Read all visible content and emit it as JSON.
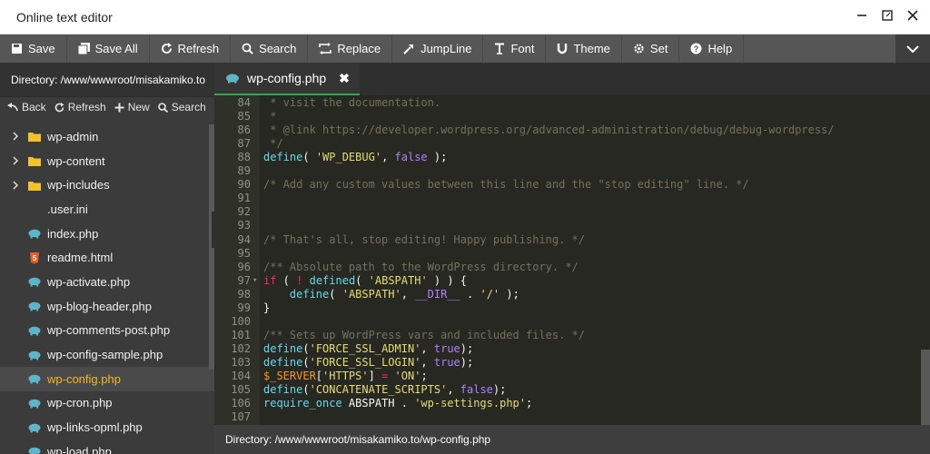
{
  "window": {
    "title": "Online text editor"
  },
  "toolbar": {
    "buttons": [
      {
        "label": "Save",
        "icon": "save-icon"
      },
      {
        "label": "Save All",
        "icon": "save-all-icon"
      },
      {
        "label": "Refresh",
        "icon": "refresh-icon"
      },
      {
        "label": "Search",
        "icon": "search-icon"
      },
      {
        "label": "Replace",
        "icon": "replace-icon"
      },
      {
        "label": "JumpLine",
        "icon": "jumpline-icon"
      },
      {
        "label": "Font",
        "icon": "font-icon"
      },
      {
        "label": "Theme",
        "icon": "theme-icon"
      },
      {
        "label": "Set",
        "icon": "gear-icon"
      },
      {
        "label": "Help",
        "icon": "help-icon"
      }
    ]
  },
  "sidebar": {
    "directory_label": "Directory: /www/wwwroot/misakamiko.to",
    "actions": [
      {
        "label": "Back",
        "icon": "back-icon"
      },
      {
        "label": "Refresh",
        "icon": "refresh-icon"
      },
      {
        "label": "New",
        "icon": "plus-icon"
      },
      {
        "label": "Search",
        "icon": "search-icon"
      }
    ],
    "files": [
      {
        "name": "wp-admin",
        "type": "folder"
      },
      {
        "name": "wp-content",
        "type": "folder"
      },
      {
        "name": "wp-includes",
        "type": "folder"
      },
      {
        "name": ".user.ini",
        "type": "file"
      },
      {
        "name": "index.php",
        "type": "php"
      },
      {
        "name": "readme.html",
        "type": "html"
      },
      {
        "name": "wp-activate.php",
        "type": "php"
      },
      {
        "name": "wp-blog-header.php",
        "type": "php"
      },
      {
        "name": "wp-comments-post.php",
        "type": "php"
      },
      {
        "name": "wp-config-sample.php",
        "type": "php"
      },
      {
        "name": "wp-config.php",
        "type": "php",
        "active": true
      },
      {
        "name": "wp-cron.php",
        "type": "php"
      },
      {
        "name": "wp-links-opml.php",
        "type": "php"
      },
      {
        "name": "wp-load.php",
        "type": "php"
      }
    ]
  },
  "tab": {
    "label": "wp-config.php",
    "close": "✖"
  },
  "editor": {
    "lines": [
      {
        "n": "84",
        "t": [
          [
            "c-comment",
            " * visit the documentation."
          ]
        ]
      },
      {
        "n": "85",
        "t": [
          [
            "c-comment",
            " *"
          ]
        ]
      },
      {
        "n": "86",
        "t": [
          [
            "c-comment",
            " * @link https://developer.wordpress.org/advanced-administration/debug/debug-wordpress/"
          ]
        ]
      },
      {
        "n": "87",
        "t": [
          [
            "c-comment",
            " */"
          ]
        ]
      },
      {
        "n": "88",
        "t": [
          [
            "c-fn",
            "define"
          ],
          [
            "",
            "( "
          ],
          [
            "c-str",
            "'WP_DEBUG'"
          ],
          [
            "",
            ", "
          ],
          [
            "c-const",
            "false"
          ],
          [
            "",
            " );"
          ]
        ]
      },
      {
        "n": "89",
        "t": []
      },
      {
        "n": "90",
        "t": [
          [
            "c-comment",
            "/* Add any custom values between this line and the \"stop editing\" line. */"
          ]
        ]
      },
      {
        "n": "91",
        "t": []
      },
      {
        "n": "92",
        "t": []
      },
      {
        "n": "93",
        "t": []
      },
      {
        "n": "94",
        "t": [
          [
            "c-comment",
            "/* That's all, stop editing! Happy publishing. */"
          ]
        ]
      },
      {
        "n": "95",
        "t": []
      },
      {
        "n": "96",
        "t": [
          [
            "c-comment",
            "/** Absolute path to the WordPress directory. */"
          ]
        ]
      },
      {
        "n": "97",
        "fold": "▾",
        "t": [
          [
            "c-kw",
            "if"
          ],
          [
            "",
            " ( "
          ],
          [
            "c-kw",
            "!"
          ],
          [
            "",
            " "
          ],
          [
            "c-fn",
            "defined"
          ],
          [
            "",
            "( "
          ],
          [
            "c-str",
            "'ABSPATH'"
          ],
          [
            "",
            " ) ) {"
          ]
        ]
      },
      {
        "n": "98",
        "t": [
          [
            "",
            "    "
          ],
          [
            "c-fn",
            "define"
          ],
          [
            "",
            "( "
          ],
          [
            "c-str",
            "'ABSPATH'"
          ],
          [
            "",
            ", "
          ],
          [
            "c-const",
            "__DIR__"
          ],
          [
            "",
            " . "
          ],
          [
            "c-str",
            "'/'"
          ],
          [
            "",
            " );"
          ]
        ]
      },
      {
        "n": "99",
        "t": [
          [
            "",
            "}"
          ]
        ]
      },
      {
        "n": "100",
        "t": []
      },
      {
        "n": "101",
        "t": [
          [
            "c-comment",
            "/** Sets up WordPress vars and included files. */"
          ]
        ]
      },
      {
        "n": "102",
        "t": [
          [
            "c-fn",
            "define"
          ],
          [
            "",
            "("
          ],
          [
            "c-str",
            "'FORCE_SSL_ADMIN'"
          ],
          [
            "",
            ", "
          ],
          [
            "c-const",
            "true"
          ],
          [
            "",
            ");"
          ]
        ]
      },
      {
        "n": "103",
        "t": [
          [
            "c-fn",
            "define"
          ],
          [
            "",
            "("
          ],
          [
            "c-str",
            "'FORCE_SSL_LOGIN'"
          ],
          [
            "",
            ", "
          ],
          [
            "c-const",
            "true"
          ],
          [
            "",
            ");"
          ]
        ]
      },
      {
        "n": "104",
        "t": [
          [
            "c-var",
            "$_SERVER"
          ],
          [
            "",
            "["
          ],
          [
            "c-str",
            "'HTTPS'"
          ],
          [
            "",
            "] "
          ],
          [
            "c-kw",
            "="
          ],
          [
            "",
            " "
          ],
          [
            "c-str",
            "'ON'"
          ],
          [
            "",
            ";"
          ]
        ]
      },
      {
        "n": "105",
        "t": [
          [
            "c-fn",
            "define"
          ],
          [
            "",
            "("
          ],
          [
            "c-str",
            "'CONCATENATE_SCRIPTS'"
          ],
          [
            "",
            ", "
          ],
          [
            "c-const",
            "false"
          ],
          [
            "",
            ");"
          ]
        ]
      },
      {
        "n": "106",
        "t": [
          [
            "c-fn",
            "require_once"
          ],
          [
            "",
            " ABSPATH . "
          ],
          [
            "c-str",
            "'wp-settings.php'"
          ],
          [
            "",
            ";"
          ]
        ]
      },
      {
        "n": "107",
        "t": []
      }
    ]
  },
  "status": {
    "path": "Directory: /www/wwwroot/misakamiko.to/wp-config.php"
  },
  "colors": {
    "accent": "#2eaa4e",
    "active_file": "#f6b52b",
    "php_icon": "#5fb4c8",
    "folder": "#f2c12e",
    "html_icon": "#e45d27"
  }
}
